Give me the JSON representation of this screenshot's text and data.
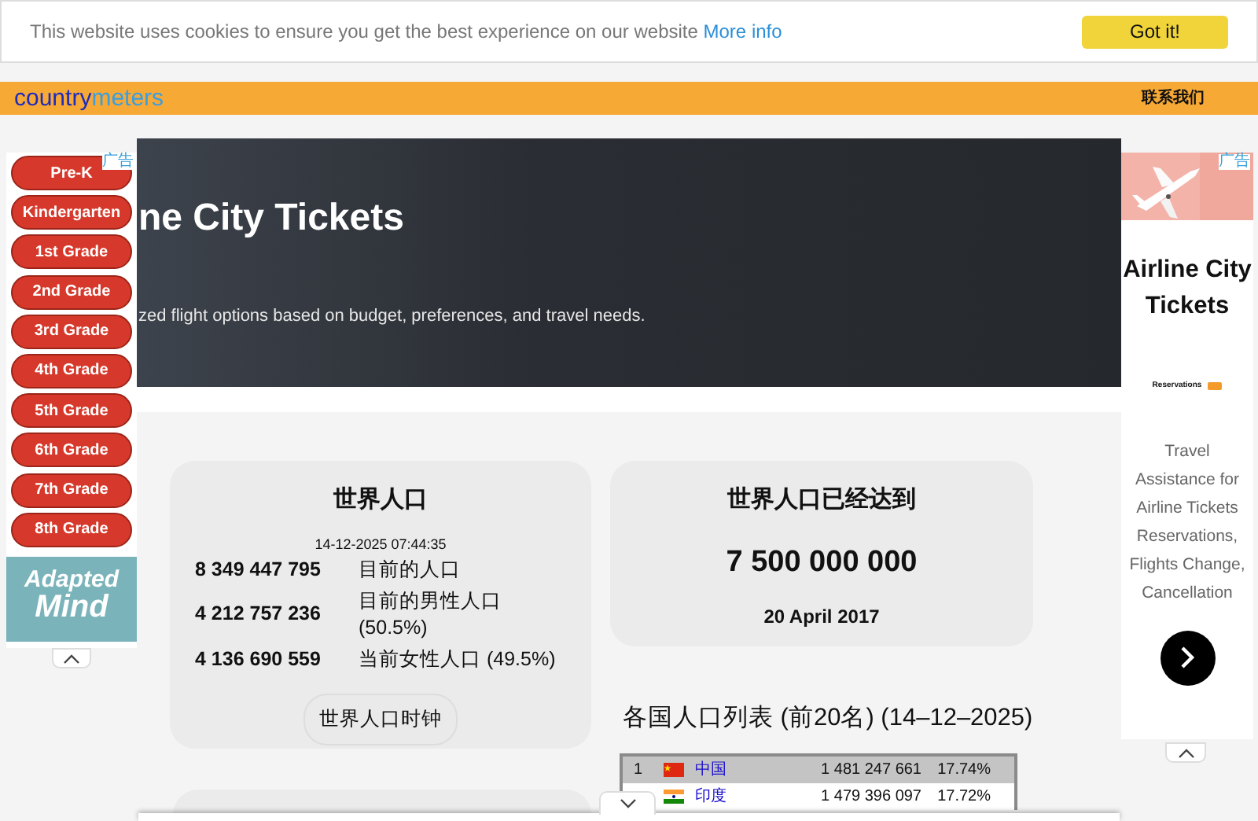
{
  "cookie_notice": {
    "text": "This website uses cookies to ensure you get the best experience on our website",
    "link": "More info",
    "button": "Got it!"
  },
  "header": {
    "logo_parts": [
      "country",
      "meters"
    ],
    "contact_link": "联系我们"
  },
  "banner": {
    "title": "ne City Tickets",
    "subtitle": "zed flight options based on budget, preferences, and travel needs."
  },
  "world_population_card": {
    "title": "世界人口",
    "timestamp": "14-12-2025 07:44:35",
    "stats": [
      {
        "value": "8 349 447 795",
        "label": "目前的人口"
      },
      {
        "value": "4 212 757 236",
        "label": "目前的男性人口 (50.5%)"
      },
      {
        "value": "4 136 690 559",
        "label": "当前女性人口 (49.5%)"
      }
    ],
    "button": "世界人口时钟"
  },
  "milestone_card": {
    "title": "世界人口已经达到",
    "value": "7 500 000 000",
    "date": "20 April 2017"
  },
  "country_table": {
    "title": "各国人口列表 (前20名) (14–12–2025)",
    "rows": [
      {
        "rank": "1",
        "flag": {
          "kind": "star",
          "color": "#de2910"
        },
        "name": "中国",
        "population": "1 481 247 661",
        "share": "17.74%",
        "highlighted": true
      },
      {
        "flag": {
          "kind": "stripes",
          "color": "#ff9933"
        },
        "name": "印度",
        "population": "1 479 396 097",
        "share": "17.72%",
        "highlighted": false
      }
    ]
  },
  "left_ad": {
    "label": "广告",
    "grades": [
      "Pre-K",
      "Kindergarten",
      "1st Grade",
      "2nd Grade",
      "3rd Grade",
      "4th Grade",
      "5th Grade",
      "6th Grade",
      "7th Grade",
      "8th Grade"
    ],
    "brand": [
      "Adapted",
      "Mind"
    ]
  },
  "right_ad": {
    "label": "广告",
    "title": "Airline City Tickets",
    "brand": "Reservations",
    "text": "Travel Assistance for Airline Tickets Reservations, Flights Change, Cancellation"
  }
}
